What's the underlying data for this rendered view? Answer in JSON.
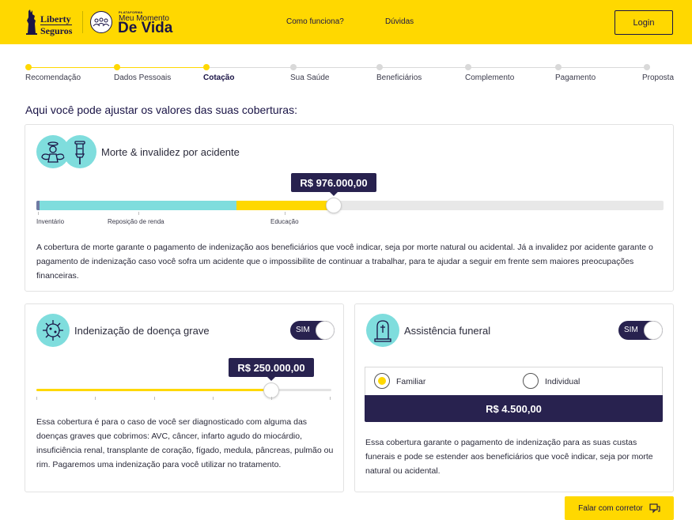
{
  "header": {
    "brand_liberty_line1": "Liberty",
    "brand_liberty_line2": "Seguros",
    "brand_small": "PLATAFORMA",
    "brand_line1": "Meu Momento",
    "brand_line2": "De Vida",
    "nav": [
      {
        "label": "Como funciona?"
      },
      {
        "label": "Dúvidas"
      }
    ],
    "login_label": "Login"
  },
  "stepper": {
    "steps": [
      {
        "label": "Recomendação",
        "state": "done"
      },
      {
        "label": "Dados Pessoais",
        "state": "done"
      },
      {
        "label": "Cotação",
        "state": "active"
      },
      {
        "label": "Sua Saúde",
        "state": "pending"
      },
      {
        "label": "Beneficiários",
        "state": "pending"
      },
      {
        "label": "Complemento",
        "state": "pending"
      },
      {
        "label": "Pagamento",
        "state": "pending"
      },
      {
        "label": "Proposta",
        "state": "pending"
      }
    ]
  },
  "page_title": "Aqui você pode ajustar os valores das suas coberturas:",
  "morte": {
    "title": "Morte & invalidez por acidente",
    "value_label": "R$   976.000,00",
    "level": 0.47,
    "ticks": [
      {
        "label": "Inventário"
      },
      {
        "label": "Reposição de renda"
      },
      {
        "label": "Educação"
      }
    ],
    "description": "A cobertura de morte garante o pagamento de indenização aos beneficiários que você indicar, seja por morte natural ou acidental. Já a invalidez por acidente garante o pagamento de indenização caso você sofra um acidente que o impossibilite de continuar a trabalhar, para te ajudar a seguir em frente sem maiores preocupações financeiras."
  },
  "doenca": {
    "title": "Indenização de doença grave",
    "toggle_label": "SIM",
    "value_label": "R$ 250.000,00",
    "level": 0.8,
    "description": "Essa cobertura é para o caso de você ser diagnosticado com alguma das doenças graves que cobrimos: AVC, câncer, infarto agudo do miocárdio, insuficiência renal, transplante de coração, fígado, medula, pâncreas, pulmão ou rim. Pagaremos uma indenização para você utilizar no tratamento."
  },
  "funeral": {
    "title": "Assistência funeral",
    "toggle_label": "SIM",
    "options": [
      {
        "label": "Familiar",
        "selected": true
      },
      {
        "label": "Individual",
        "selected": false
      }
    ],
    "price": "R$ 4.500,00",
    "description": "Essa cobertura garante o pagamento de indenização para as suas custas funerais e pode se estender aos beneficiários que você indicar, seja por morte natural ou acidental."
  },
  "falar_label": "Falar com corretor",
  "colors": {
    "brand_yellow": "#ffd800",
    "navy": "#28224f",
    "teal": "#7fdddd"
  }
}
